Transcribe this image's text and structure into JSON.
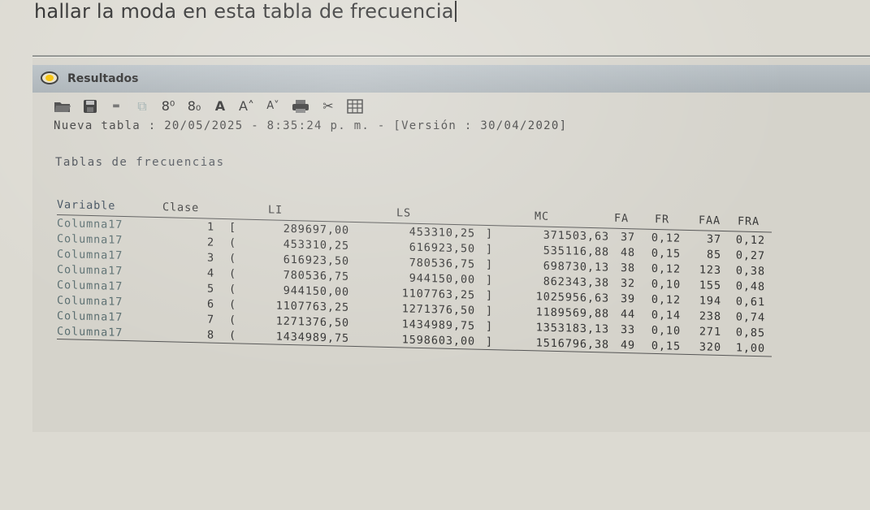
{
  "question": "hallar la moda en esta tabla de frecuencia",
  "window": {
    "title": "Resultados",
    "toolbar": [
      {
        "name": "open-folder-icon",
        "kind": "svg"
      },
      {
        "name": "save-icon",
        "kind": "svg"
      },
      {
        "name": "minus-icon",
        "kind": "text",
        "label": "▬"
      },
      {
        "name": "copy-icon",
        "kind": "text",
        "label": "⧉"
      },
      {
        "name": "decimals-more-button",
        "kind": "text",
        "label": "8⁰"
      },
      {
        "name": "decimals-less-button",
        "kind": "text",
        "label": "8₀"
      },
      {
        "name": "font-button",
        "kind": "text",
        "label": "A"
      },
      {
        "name": "font-increase-button",
        "kind": "text",
        "label": "A˄"
      },
      {
        "name": "font-decrease-button",
        "kind": "text",
        "label": "A˅"
      },
      {
        "name": "print-icon",
        "kind": "svg"
      },
      {
        "name": "clear-icon",
        "kind": "text",
        "label": "✂"
      },
      {
        "name": "table-grid-icon",
        "kind": "svg"
      }
    ],
    "newtable_line": "Nueva tabla : 20/05/2025 - 8:35:24 p. m. - [Versión : 30/04/2020]",
    "section_title": "Tablas de frecuencias"
  },
  "table": {
    "headers": {
      "variable": "Variable",
      "clase": "Clase",
      "li": "LI",
      "ls": "LS",
      "mc": "MC",
      "fa": "FA",
      "fr": "FR",
      "faa": "FAA",
      "fra": "FRA"
    },
    "rows": [
      {
        "variable": "Columna17",
        "clase": "1",
        "open": "[",
        "li": "289697,00",
        "ls": "453310,25",
        "close": "]",
        "mc": "371503,63",
        "fa": "37",
        "fr": "0,12",
        "faa": "37",
        "fra": "0,12"
      },
      {
        "variable": "Columna17",
        "clase": "2",
        "open": "(",
        "li": "453310,25",
        "ls": "616923,50",
        "close": "]",
        "mc": "535116,88",
        "fa": "48",
        "fr": "0,15",
        "faa": "85",
        "fra": "0,27"
      },
      {
        "variable": "Columna17",
        "clase": "3",
        "open": "(",
        "li": "616923,50",
        "ls": "780536,75",
        "close": "]",
        "mc": "698730,13",
        "fa": "38",
        "fr": "0,12",
        "faa": "123",
        "fra": "0,38"
      },
      {
        "variable": "Columna17",
        "clase": "4",
        "open": "(",
        "li": "780536,75",
        "ls": "944150,00",
        "close": "]",
        "mc": "862343,38",
        "fa": "32",
        "fr": "0,10",
        "faa": "155",
        "fra": "0,48"
      },
      {
        "variable": "Columna17",
        "clase": "5",
        "open": "(",
        "li": "944150,00",
        "ls": "1107763,25",
        "close": "]",
        "mc": "1025956,63",
        "fa": "39",
        "fr": "0,12",
        "faa": "194",
        "fra": "0,61"
      },
      {
        "variable": "Columna17",
        "clase": "6",
        "open": "(",
        "li": "1107763,25",
        "ls": "1271376,50",
        "close": "]",
        "mc": "1189569,88",
        "fa": "44",
        "fr": "0,14",
        "faa": "238",
        "fra": "0,74"
      },
      {
        "variable": "Columna17",
        "clase": "7",
        "open": "(",
        "li": "1271376,50",
        "ls": "1434989,75",
        "close": "]",
        "mc": "1353183,13",
        "fa": "33",
        "fr": "0,10",
        "faa": "271",
        "fra": "0,85"
      },
      {
        "variable": "Columna17",
        "clase": "8",
        "open": "(",
        "li": "1434989,75",
        "ls": "1598603,00",
        "close": "]",
        "mc": "1516796,38",
        "fa": "49",
        "fr": "0,15",
        "faa": "320",
        "fra": "1,00"
      }
    ]
  }
}
